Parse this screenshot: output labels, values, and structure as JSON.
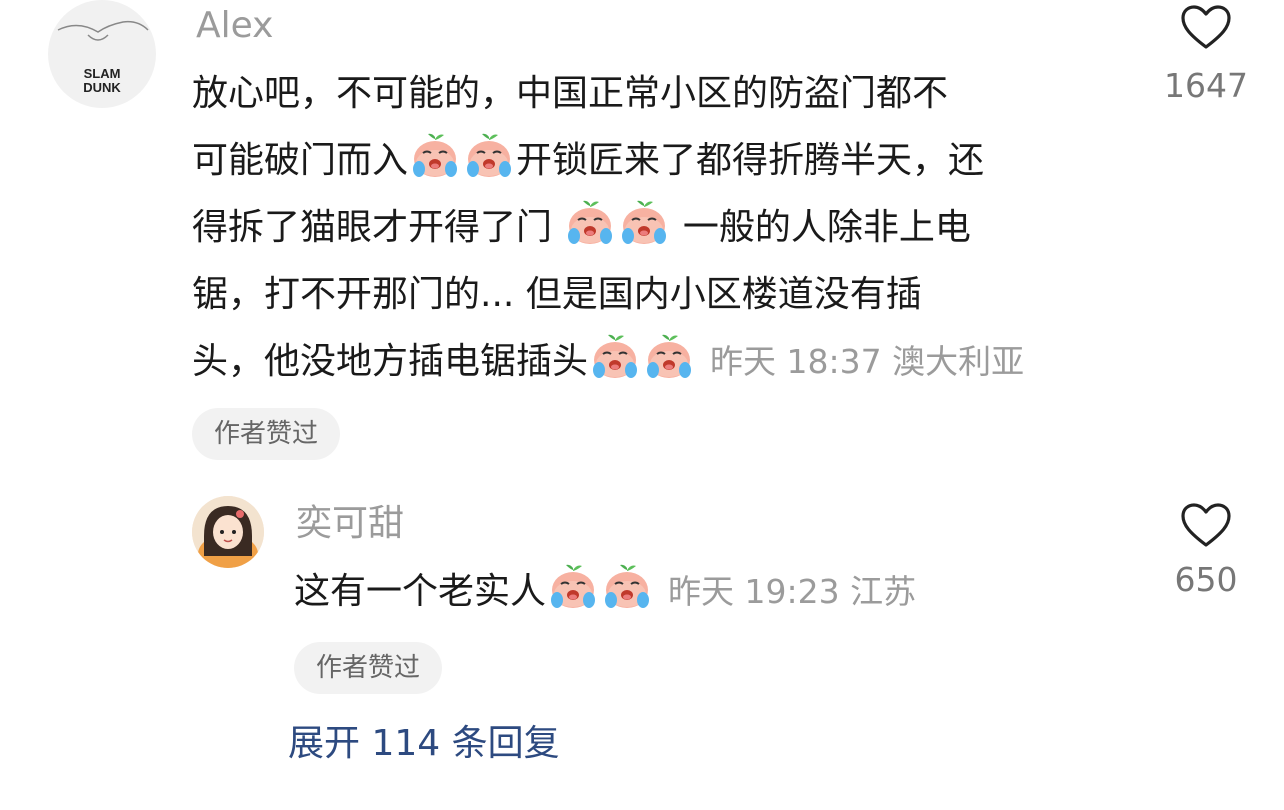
{
  "comment": {
    "username": "Alex",
    "avatar_text": [
      "SLAM",
      "DUNK"
    ],
    "text_lines": [
      "放心吧，不可能的，中国正常小区的防盗门都不",
      "可能破门而入",
      "开锁匠来了都得折腾半天，还",
      "得拆了猫眼才开得了门 ",
      " 一般的人除非上电",
      "锯，打不开那门的... 但是国内小区楼道没有插",
      "头，他没地方插电锯插头"
    ],
    "time_location": "昨天 18:37 澳大利亚",
    "author_liked": "作者赞过",
    "like_icon": "heart-outline-icon",
    "like_count": "1647"
  },
  "reply": {
    "username": "奕可甜",
    "text": "这有一个老实人",
    "time_location": "昨天 19:23 江苏",
    "author_liked": "作者赞过",
    "like_icon": "heart-outline-icon",
    "like_count": "650"
  },
  "expand_replies": "展开 114 条回复",
  "colors": {
    "link": "#2d4a80",
    "muted": "#9b9b9b",
    "badge_bg": "#f2f2f2"
  }
}
